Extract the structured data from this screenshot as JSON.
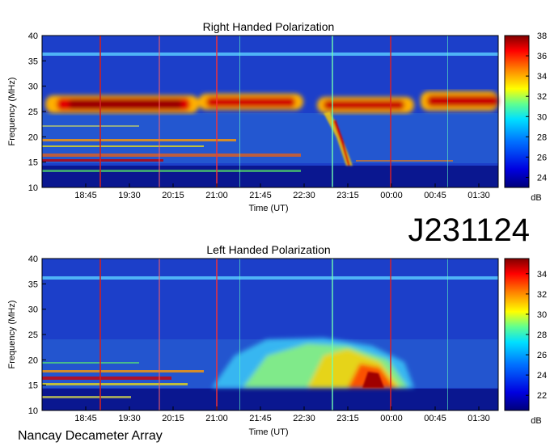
{
  "figure_id": "J231124",
  "footer": "Nancay Decameter Array",
  "chart_data": [
    {
      "type": "heatmap",
      "title": "Right Handed Polarization",
      "xlabel": "Time (UT)",
      "ylabel": "Frequency (MHz)",
      "x_ticks": [
        "18:45",
        "19:30",
        "20:15",
        "21:00",
        "21:45",
        "22:30",
        "23:15",
        "00:00",
        "00:45",
        "01:30"
      ],
      "y_ticks": [
        10,
        15,
        20,
        25,
        30,
        35,
        40
      ],
      "ylim": [
        10,
        40
      ],
      "colorbar": {
        "label": "dB",
        "range": [
          23,
          38
        ],
        "ticks": [
          24,
          26,
          28,
          30,
          32,
          34,
          36,
          38
        ]
      },
      "features": [
        {
          "name": "intense band",
          "freq_mhz": [
            24.5,
            28
          ],
          "time_ut": [
            "18:00",
            "23:00"
          ]
        },
        {
          "name": "intense band",
          "freq_mhz": [
            24.5,
            27.5
          ],
          "time_ut": [
            "23:00",
            "00:30"
          ]
        },
        {
          "name": "intense band",
          "freq_mhz": [
            25,
            28.5
          ],
          "time_ut": [
            "00:45",
            "01:50"
          ]
        },
        {
          "name": "drifting burst",
          "freq_mhz": [
            14,
            25
          ],
          "time_ut": [
            "22:55",
            "23:15"
          ]
        },
        {
          "name": "RFI line",
          "freq_mhz": [
            36,
            36.5
          ],
          "time_ut": [
            "18:00",
            "01:50"
          ]
        },
        {
          "name": "low band noise",
          "freq_mhz": [
            11,
            14
          ],
          "time_ut": [
            "18:00",
            "20:30"
          ]
        }
      ]
    },
    {
      "type": "heatmap",
      "title": "Left Handed Polarization",
      "xlabel": "Time (UT)",
      "ylabel": "Frequency (MHz)",
      "x_ticks": [
        "18:45",
        "19:30",
        "20:15",
        "21:00",
        "21:45",
        "22:30",
        "23:15",
        "00:00",
        "00:45",
        "01:30"
      ],
      "y_ticks": [
        10,
        15,
        20,
        25,
        30,
        35,
        40
      ],
      "ylim": [
        10,
        40
      ],
      "colorbar": {
        "label": "dB",
        "range": [
          20.5,
          35.5
        ],
        "ticks": [
          22,
          24,
          26,
          28,
          30,
          32,
          34
        ]
      },
      "features": [
        {
          "name": "emission arc",
          "freq_mhz": [
            14,
            24
          ],
          "time_ut": [
            "21:00",
            "00:30"
          ]
        },
        {
          "name": "RFI line",
          "freq_mhz": [
            36,
            36.5
          ],
          "time_ut": [
            "18:00",
            "01:50"
          ]
        },
        {
          "name": "low band noise",
          "freq_mhz": [
            11,
            18
          ],
          "time_ut": [
            "18:00",
            "20:15"
          ]
        }
      ]
    }
  ]
}
